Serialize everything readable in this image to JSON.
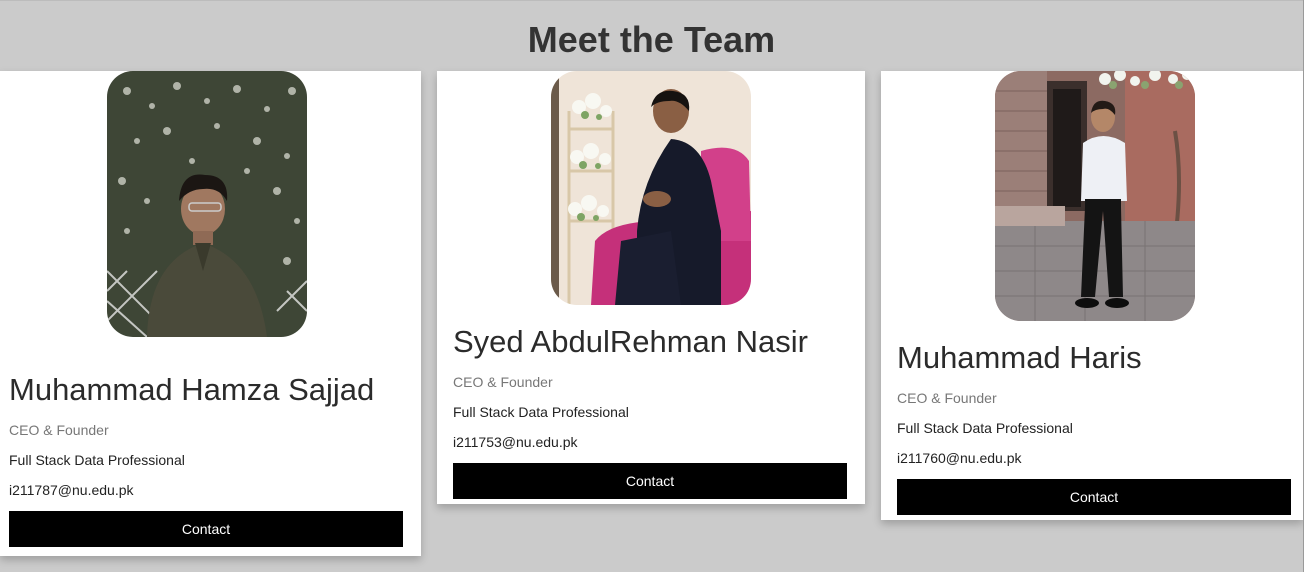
{
  "header": {
    "title": "Meet the Team"
  },
  "team": [
    {
      "name": "Muhammad Hamza Sajjad",
      "role": "CEO & Founder",
      "description": "Full Stack Data Professional",
      "email": "i211787@nu.edu.pk",
      "button_label": "Contact",
      "photo_icon": "team-member-photo"
    },
    {
      "name": "Syed AbdulRehman Nasir",
      "role": "CEO & Founder",
      "description": "Full Stack Data Professional",
      "email": "i211753@nu.edu.pk",
      "button_label": "Contact",
      "photo_icon": "team-member-photo"
    },
    {
      "name": "Muhammad Haris",
      "role": "CEO & Founder",
      "description": "Full Stack Data Professional",
      "email": "i211760@nu.edu.pk",
      "button_label": "Contact",
      "photo_icon": "team-member-photo"
    }
  ],
  "colors": {
    "background": "#cbcbcb",
    "card": "#ffffff",
    "button": "#000000",
    "button_text": "#ffffff",
    "role_text": "#777777"
  }
}
